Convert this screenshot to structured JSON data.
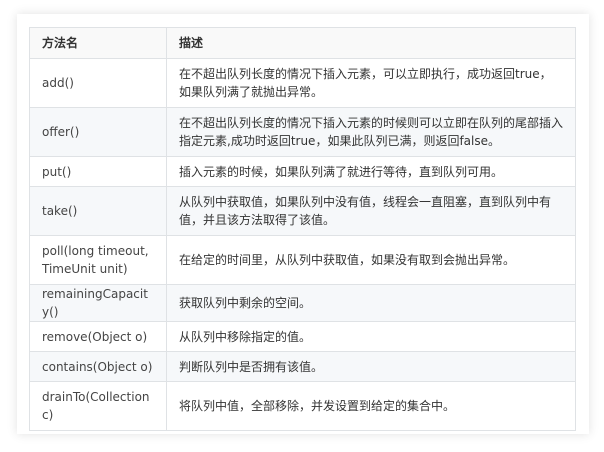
{
  "table": {
    "headers": [
      "方法名",
      "描述"
    ],
    "rows": [
      {
        "method": "add()",
        "desc": "在不超出队列长度的情况下插入元素，可以立即执行，成功返回true，如果队列满了就抛出异常。"
      },
      {
        "method": "offer()",
        "desc": "在不超出队列长度的情况下插入元素的时候则可以立即在队列的尾部插入指定元素,成功时返回true，如果此队列已满，则返回false。"
      },
      {
        "method": "put()",
        "desc": "插入元素的时候，如果队列满了就进行等待，直到队列可用。"
      },
      {
        "method": "take()",
        "desc": "从队列中获取值，如果队列中没有值，线程会一直阻塞，直到队列中有值，并且该方法取得了该值。"
      },
      {
        "method": "poll(long timeout, TimeUnit unit)",
        "desc": "在给定的时间里，从队列中获取值，如果没有取到会抛出异常。"
      },
      {
        "method": "remainingCapacity()",
        "desc": "获取队列中剩余的空间。"
      },
      {
        "method": "remove(Object o)",
        "desc": "从队列中移除指定的值。"
      },
      {
        "method": "contains(Object o)",
        "desc": "判断队列中是否拥有该值。"
      },
      {
        "method": "drainTo(Collection c)",
        "desc": "将队列中值，全部移除，并发设置到给定的集合中。"
      }
    ]
  }
}
